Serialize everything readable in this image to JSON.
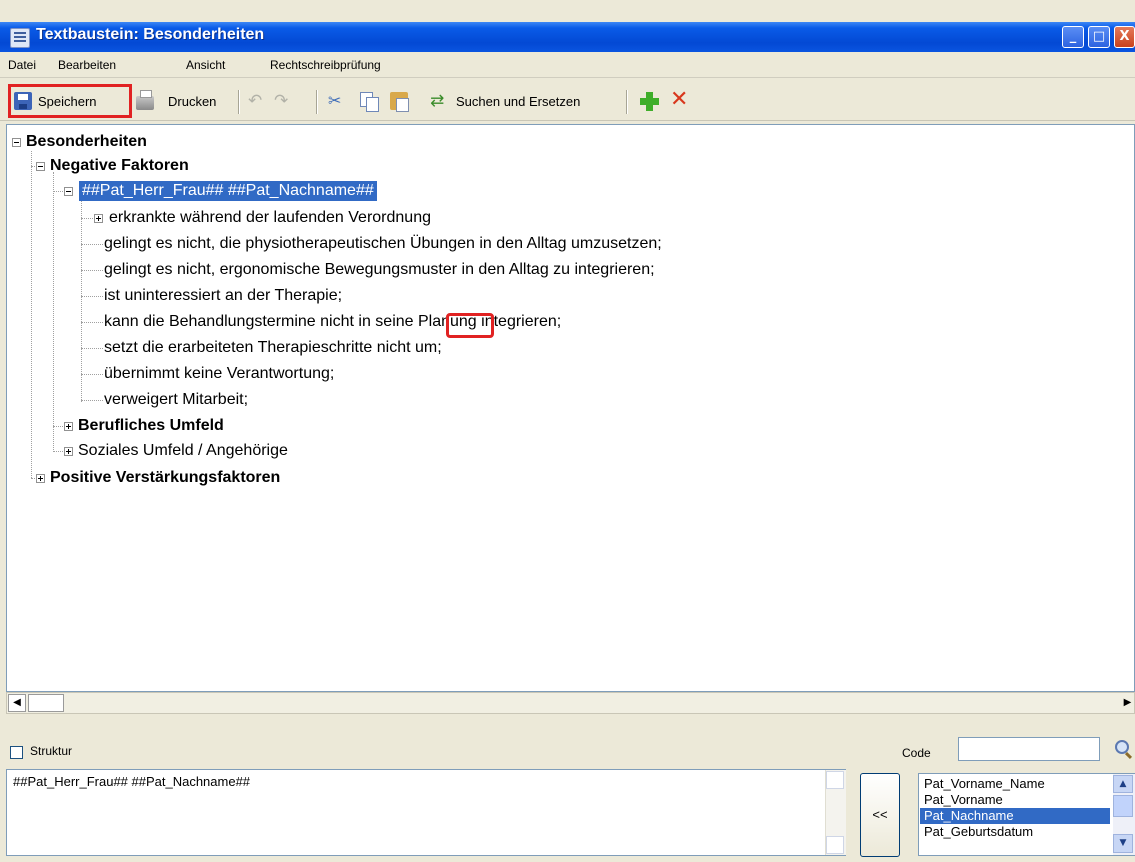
{
  "window": {
    "title": "Textbaustein: Besonderheiten",
    "controls": {
      "minimize": "_",
      "maximize": "□",
      "close": "X"
    }
  },
  "menu": [
    "Datei",
    "Bearbeiten",
    "Ansicht",
    "Rechtschreibprüfung"
  ],
  "toolbar": {
    "save_label": "Speichern",
    "print_label": "Drucken",
    "search_replace_label": "Suchen und Ersetzen",
    "icons": [
      "save-icon",
      "print-icon",
      "undo-icon",
      "redo-icon",
      "cut-icon",
      "copy-icon",
      "paste-icon",
      "replace-icon",
      "add-icon",
      "delete-icon"
    ]
  },
  "tree": {
    "root": "Besonderheiten",
    "negative": "Negative Faktoren",
    "selected": "##Pat_Herr_Frau## ##Pat_Nachname##",
    "items": [
      "erkrankte während der laufenden Verordnung",
      "gelingt es nicht, die physiotherapeutischen Übungen in den Alltag umzusetzen;",
      "gelingt es nicht, ergonomische Bewegungsmuster in den Alltag zu integrieren;",
      "ist uninteressiert an der Therapie;",
      "kann die Behandlungstermine nicht in seine Planung integrieren;",
      "setzt die erarbeiteten Therapieschritte nicht um;",
      "übernimmt keine Verantwortung;",
      "verweigert Mitarbeit;"
    ],
    "berufliches": "Berufliches Umfeld",
    "soziales": "Soziales Umfeld / Angehörige",
    "positive": "Positive Verstärkungsfaktoren"
  },
  "bottom": {
    "struktur_label": "Struktur",
    "code_label": "Code",
    "code_value": "",
    "text_value": "##Pat_Herr_Frau## ##Pat_Nachname##",
    "insert_label": "<<",
    "code_list": [
      "Pat_Vorname_Name",
      "Pat_Vorname",
      "Pat_Nachname",
      "Pat_Geburtsdatum"
    ],
    "code_list_selected": "Pat_Nachname"
  },
  "colors": {
    "titlebar": "#0349d4",
    "selection": "#316ac5",
    "highlight": "#e12222"
  }
}
